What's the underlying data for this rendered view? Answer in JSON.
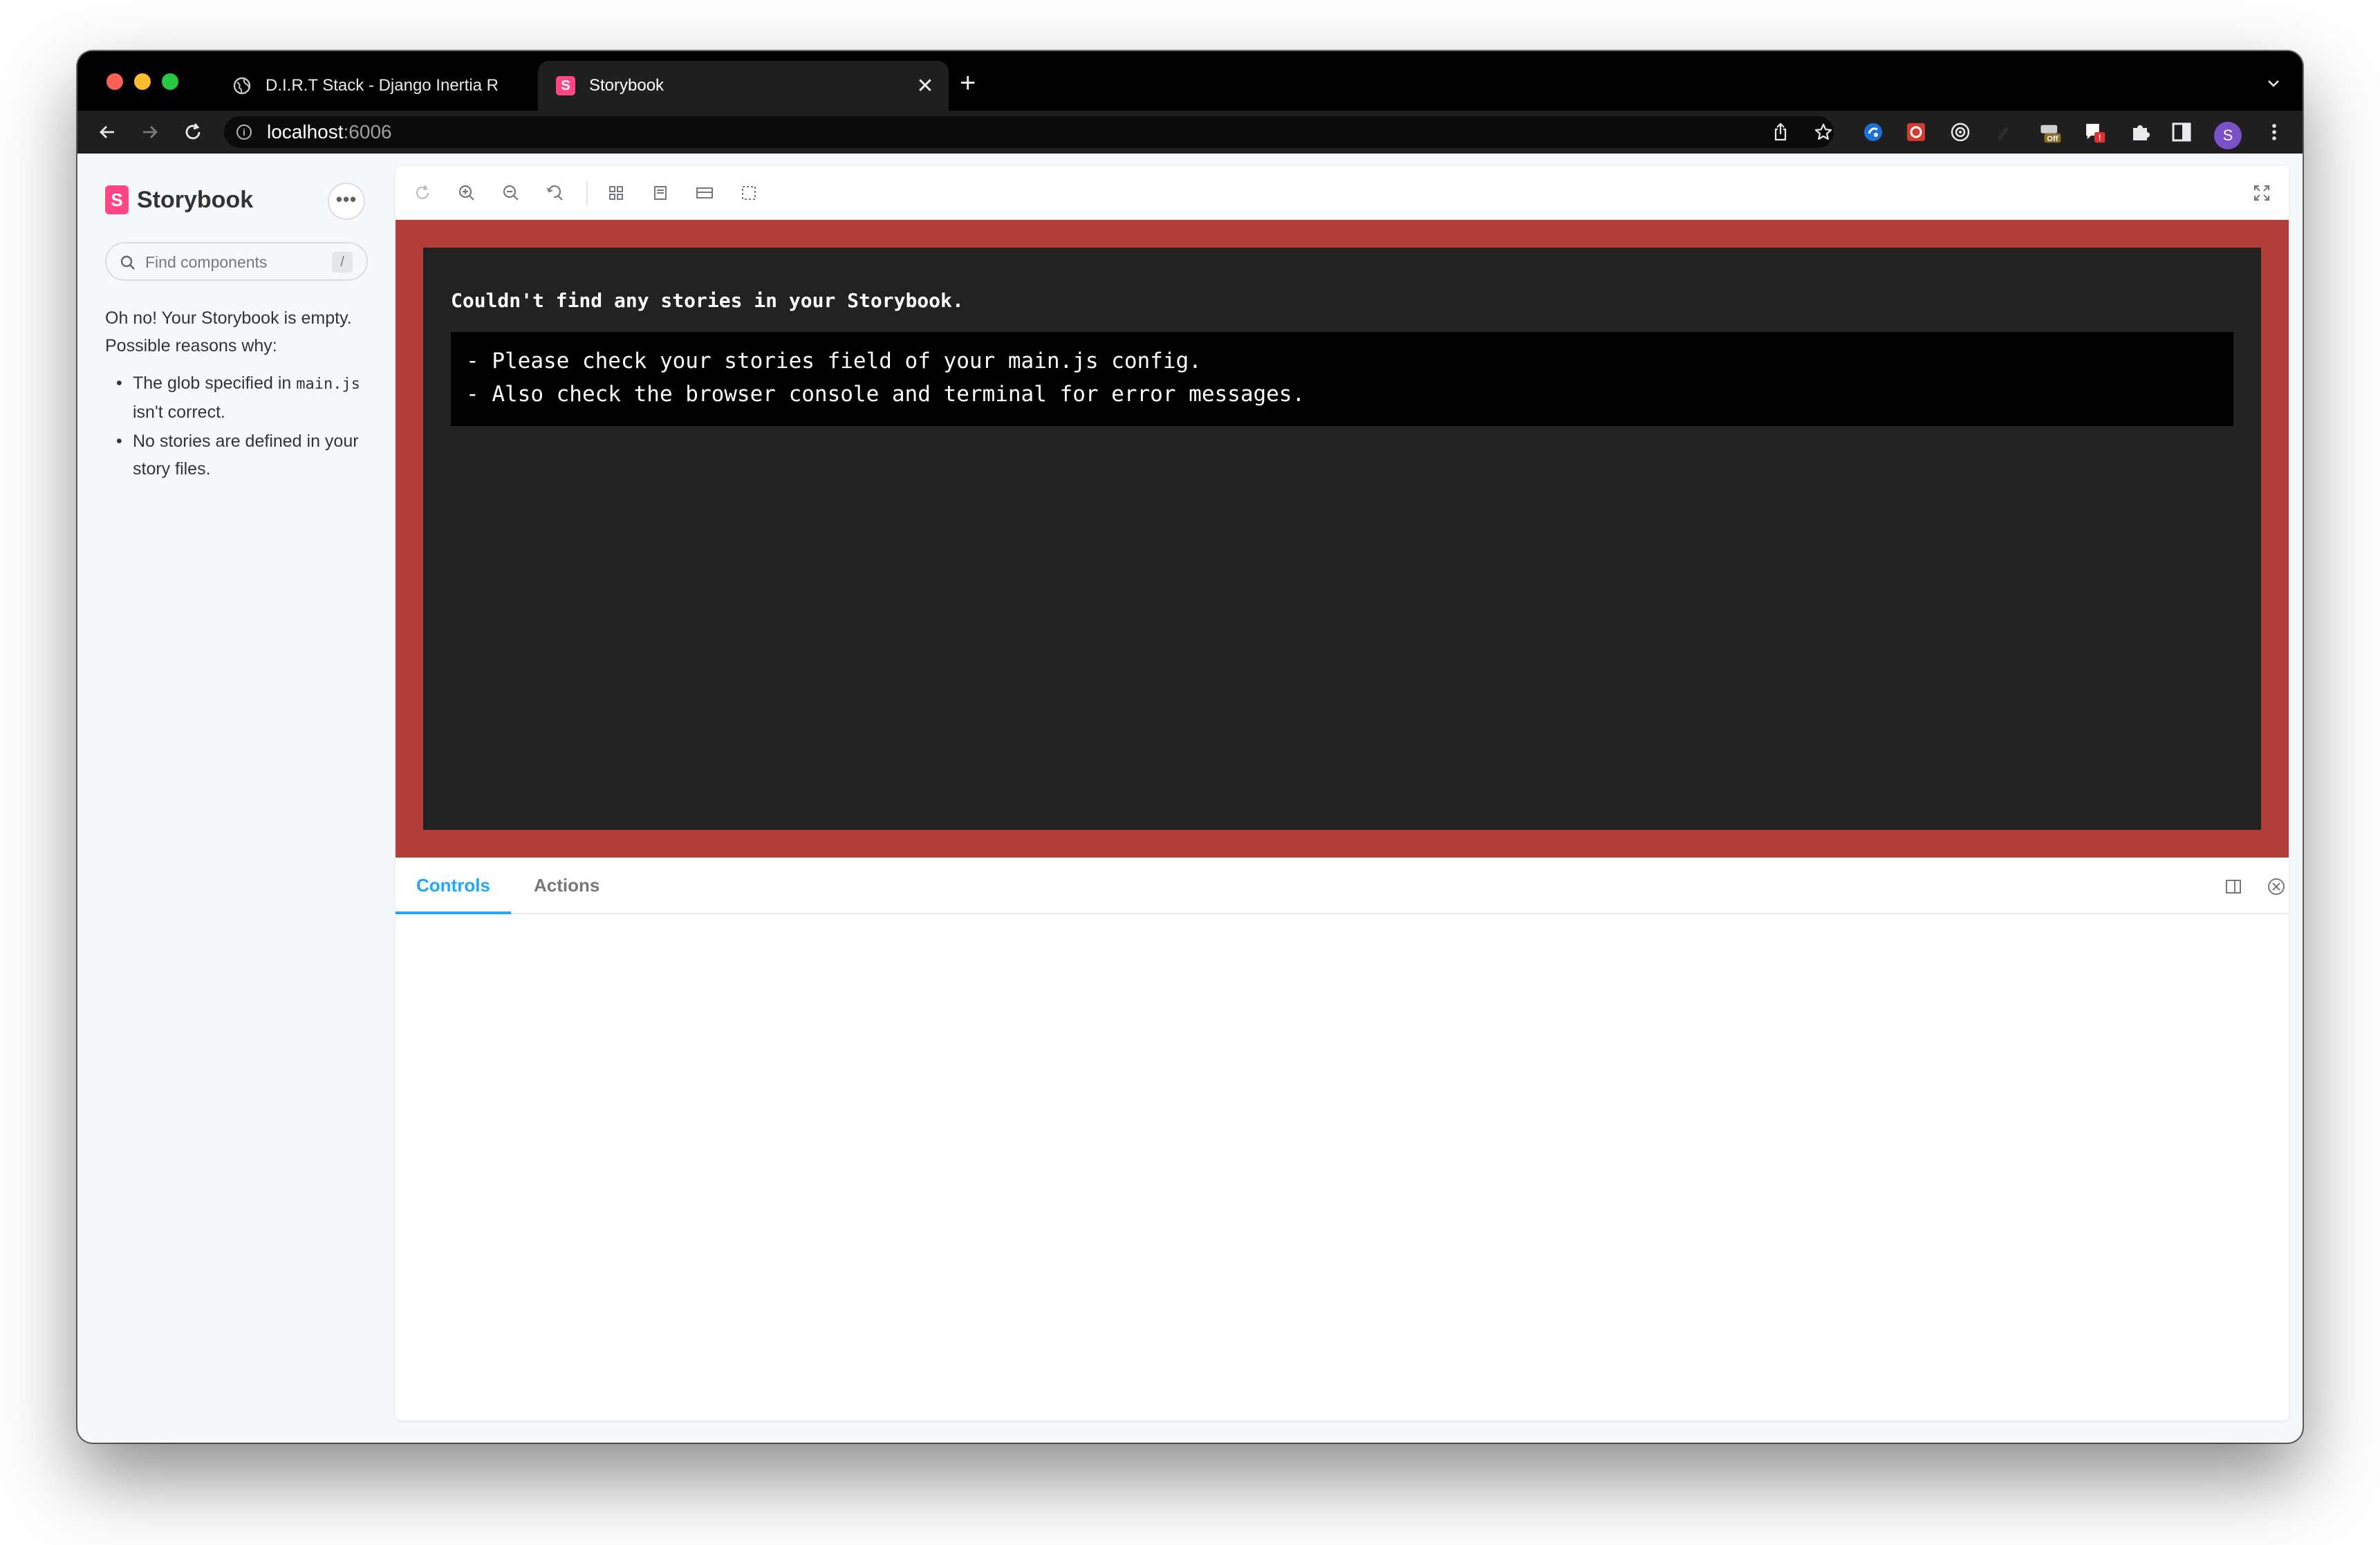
{
  "browser": {
    "tabs": [
      {
        "title": "D.I.R.T Stack - Django Inertia R",
        "active": false,
        "icon": "globe-icon"
      },
      {
        "title": "Storybook",
        "active": true,
        "icon": "storybook-favicon"
      }
    ],
    "new_tab_label": "+",
    "address": {
      "host": "localhost",
      "port": ":6006"
    },
    "extension_badges": {
      "off": "Off",
      "alert": "!"
    },
    "profile_initial": "S"
  },
  "sidebar": {
    "brand": "Storybook",
    "logo_letter": "S",
    "menu_label": "•••",
    "search": {
      "placeholder": "Find components",
      "shortcut": "/"
    },
    "empty_message": "Oh no! Your Storybook is empty. Possible reasons why:",
    "reasons": [
      {
        "before": "The glob specified in ",
        "code": "main.js",
        "after": " isn't correct."
      },
      {
        "before": "No stories are defined in your story files.",
        "code": "",
        "after": ""
      }
    ]
  },
  "preview": {
    "error_title": "Couldn't find any stories in your Storybook.",
    "error_lines": [
      "- Please check your stories field of your main.js config.",
      "- Also check the browser console and terminal for error messages."
    ],
    "canvas_color": "#b23e3a"
  },
  "addons": {
    "tabs": [
      "Controls",
      "Actions"
    ],
    "active_tab": "Controls",
    "accent": "#1ea7fd"
  }
}
